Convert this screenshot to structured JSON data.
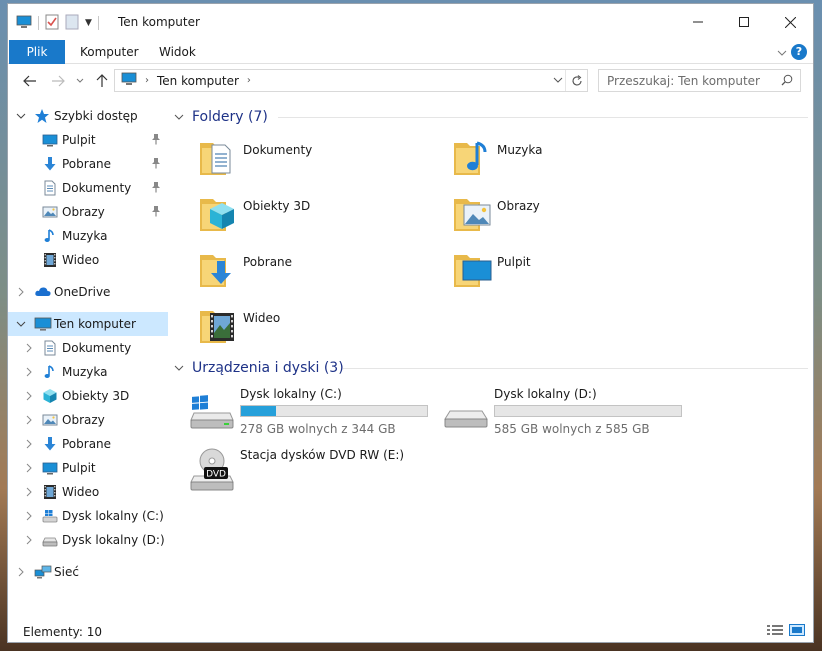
{
  "window": {
    "title": "Ten komputer"
  },
  "ribbon": {
    "tabs": [
      "Plik",
      "Komputer",
      "Widok"
    ]
  },
  "address": {
    "path": [
      "Ten komputer"
    ],
    "search_placeholder": "Przeszukaj: Ten komputer"
  },
  "sidebar": {
    "items": [
      {
        "label": "Szybki dostęp",
        "icon": "star-icon",
        "level": 0,
        "expander": "expanded",
        "pinned": false
      },
      {
        "label": "Pulpit",
        "icon": "desktop-icon",
        "level": 1,
        "expander": "none",
        "pinned": true
      },
      {
        "label": "Pobrane",
        "icon": "download-icon",
        "level": 1,
        "expander": "none",
        "pinned": true
      },
      {
        "label": "Dokumenty",
        "icon": "document-icon",
        "level": 1,
        "expander": "none",
        "pinned": true
      },
      {
        "label": "Obrazy",
        "icon": "pictures-icon",
        "level": 1,
        "expander": "none",
        "pinned": true
      },
      {
        "label": "Muzyka",
        "icon": "music-icon",
        "level": 1,
        "expander": "none",
        "pinned": false
      },
      {
        "label": "Wideo",
        "icon": "video-icon",
        "level": 1,
        "expander": "none",
        "pinned": false
      },
      {
        "label": "OneDrive",
        "icon": "cloud-icon",
        "level": 0,
        "expander": "collapsed",
        "pinned": false
      },
      {
        "label": "Ten komputer",
        "icon": "computer-icon",
        "level": 0,
        "expander": "expanded",
        "pinned": false,
        "selected": true
      },
      {
        "label": "Dokumenty",
        "icon": "document-icon",
        "level": 1,
        "expander": "collapsed",
        "pinned": false
      },
      {
        "label": "Muzyka",
        "icon": "music-icon",
        "level": 1,
        "expander": "collapsed",
        "pinned": false
      },
      {
        "label": "Obiekty 3D",
        "icon": "cube-icon",
        "level": 1,
        "expander": "collapsed",
        "pinned": false
      },
      {
        "label": "Obrazy",
        "icon": "pictures-icon",
        "level": 1,
        "expander": "collapsed",
        "pinned": false
      },
      {
        "label": "Pobrane",
        "icon": "download-icon",
        "level": 1,
        "expander": "collapsed",
        "pinned": false
      },
      {
        "label": "Pulpit",
        "icon": "desktop-icon",
        "level": 1,
        "expander": "collapsed",
        "pinned": false
      },
      {
        "label": "Wideo",
        "icon": "video-icon",
        "level": 1,
        "expander": "collapsed",
        "pinned": false
      },
      {
        "label": "Dysk lokalny (C:)",
        "icon": "windows-drive-icon",
        "level": 1,
        "expander": "collapsed",
        "pinned": false
      },
      {
        "label": "Dysk lokalny (D:)",
        "icon": "drive-icon",
        "level": 1,
        "expander": "collapsed",
        "pinned": false
      },
      {
        "label": "Sieć",
        "icon": "network-icon",
        "level": 0,
        "expander": "collapsed",
        "pinned": false
      }
    ]
  },
  "main": {
    "folders_header": "Foldery (7)",
    "folders": [
      {
        "label": "Dokumenty",
        "icon": "document-icon"
      },
      {
        "label": "Muzyka",
        "icon": "music-icon"
      },
      {
        "label": "Obiekty 3D",
        "icon": "cube-icon"
      },
      {
        "label": "Obrazy",
        "icon": "pictures-icon"
      },
      {
        "label": "Pobrane",
        "icon": "download-icon"
      },
      {
        "label": "Pulpit",
        "icon": "desktop-icon"
      },
      {
        "label": "Wideo",
        "icon": "video-icon"
      }
    ],
    "devices_header": "Urządzenia i dyski (3)",
    "drives": [
      {
        "label": "Dysk lokalny (C:)",
        "free": "278 GB wolnych z 344 GB",
        "used_fraction": 0.19,
        "icon": "windows-drive-icon"
      },
      {
        "label": "Dysk lokalny (D:)",
        "free": "585 GB wolnych z 585 GB",
        "used_fraction": 0.0,
        "icon": "drive-icon"
      },
      {
        "label": "Stacja dysków DVD RW (E:)",
        "icon": "dvd-drive-icon",
        "badge": "DVD"
      }
    ]
  },
  "status": {
    "items_count": "Elementy: 10"
  },
  "colors": {
    "accent": "#1979ca",
    "selection": "#cce8ff",
    "header_text": "#1e3287",
    "bar_fill": "#26a0da"
  }
}
